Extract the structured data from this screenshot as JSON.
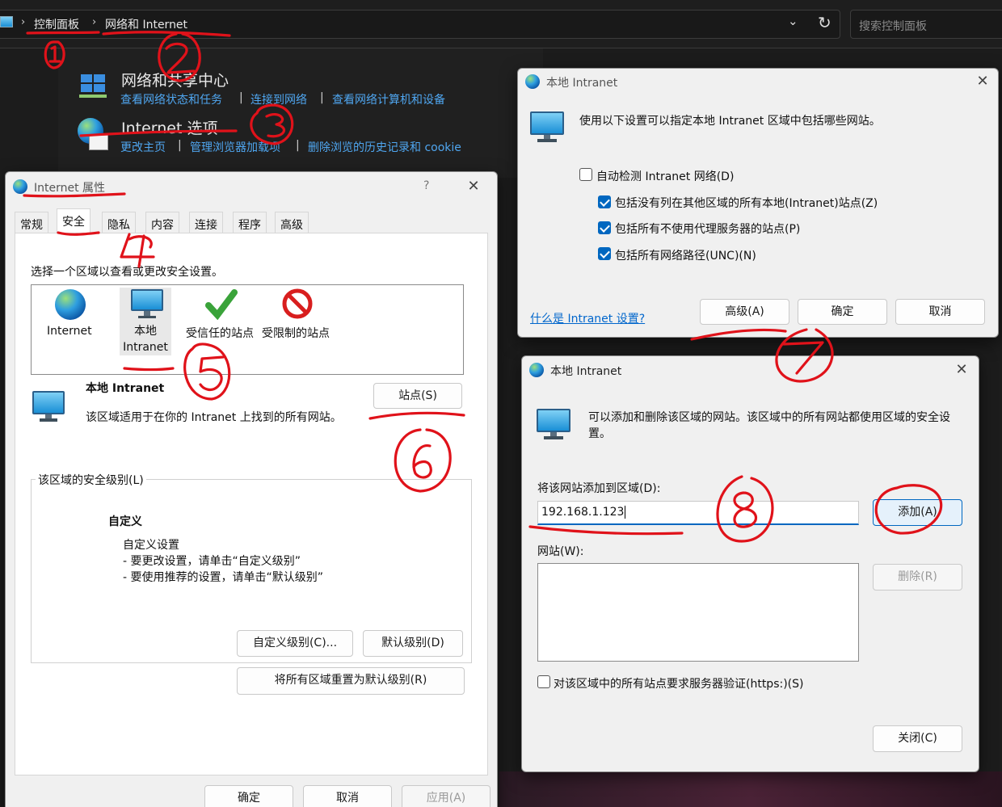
{
  "breadcrumb": {
    "item1": "控制面板",
    "item2": "网络和 Internet"
  },
  "search": {
    "placeholder": "搜索控制面板"
  },
  "control_panel": {
    "section1": {
      "title": "网络和共享中心",
      "links": [
        "查看网络状态和任务",
        "连接到网络",
        "查看网络计算机和设备"
      ]
    },
    "section2": {
      "title": "Internet 选项",
      "links": [
        "更改主页",
        "管理浏览器加载项",
        "删除浏览的历史记录和 cookie"
      ]
    }
  },
  "internet_properties": {
    "title": "Internet 属性",
    "help": "?",
    "tabs": [
      "常规",
      "安全",
      "隐私",
      "内容",
      "连接",
      "程序",
      "高级"
    ],
    "zone_prompt": "选择一个区域以查看或更改安全设置。",
    "zones": [
      "Internet",
      "本地\nIntranet",
      "受信任的站点",
      "受限制的站点"
    ],
    "zone_name": "本地 Intranet",
    "sites_button": "站点(S)",
    "zone_desc": "该区域适用于在你的 Intranet 上找到的所有网站。",
    "security_group": "该区域的安全级别(L)",
    "custom_title": "自定义",
    "custom_lines": [
      "自定义设置",
      "- 要更改设置，请单击“自定义级别”",
      "- 要使用推荐的设置，请单击“默认级别”"
    ],
    "custom_level_btn": "自定义级别(C)...",
    "default_level_btn": "默认级别(D)",
    "reset_all_btn": "将所有区域重置为默认级别(R)",
    "ok": "确定",
    "cancel": "取消",
    "apply": "应用(A)"
  },
  "intranet_dialog1": {
    "title": "本地 Intranet",
    "desc": "使用以下设置可以指定本地 Intranet 区域中包括哪些网站。",
    "options": [
      {
        "label": "自动检测 Intranet 网络(D)",
        "checked": false
      },
      {
        "label": "包括没有列在其他区域的所有本地(Intranet)站点(Z)",
        "checked": true
      },
      {
        "label": "包括所有不使用代理服务器的站点(P)",
        "checked": true
      },
      {
        "label": "包括所有网络路径(UNC)(N)",
        "checked": true
      }
    ],
    "help_link": "什么是 Intranet 设置?",
    "advanced": "高级(A)",
    "ok": "确定",
    "cancel": "取消"
  },
  "intranet_dialog2": {
    "title": "本地 Intranet",
    "desc": "可以添加和删除该区域的网站。该区域中的所有网站都使用区域的安全设置。",
    "add_label": "将该网站添加到区域(D):",
    "add_value": "192.168.1.123",
    "add_btn": "添加(A)",
    "websites_label": "网站(W):",
    "remove_btn": "删除(R)",
    "https_label": "对该区域中的所有站点要求服务器验证(https:)(S)",
    "close_btn": "关闭(C)"
  },
  "colors": {
    "accent": "#0067c0",
    "annotation": "#e0121a",
    "link": "#4fa6f0"
  }
}
